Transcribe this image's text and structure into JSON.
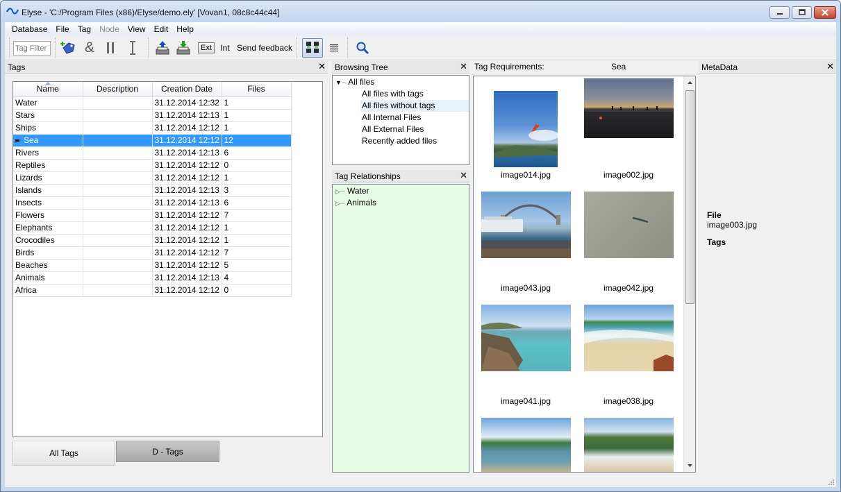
{
  "window": {
    "title": "Elyse - 'C:/Program Files (x86)/Elyse/demo.ely' [Vovan1, 08c8c44c44]"
  },
  "menu": [
    "Database",
    "File",
    "Tag",
    "Node",
    "View",
    "Edit",
    "Help"
  ],
  "toolbar": {
    "tag_filter_placeholder": "Tag Filter",
    "and_label": "&",
    "ext_label": "Ext",
    "int_label": "Int",
    "feedback_label": "Send feedback"
  },
  "tags_panel": {
    "title": "Tags",
    "columns": [
      "Name",
      "Description",
      "Creation Date",
      "Files"
    ],
    "rows": [
      {
        "name": "Water",
        "description": "",
        "date": "31.12.2014 12:32",
        "files": "1"
      },
      {
        "name": "Stars",
        "description": "",
        "date": "31.12.2014 12:13",
        "files": "1"
      },
      {
        "name": "Ships",
        "description": "",
        "date": "31.12.2014 12:12",
        "files": "1"
      },
      {
        "name": "Sea",
        "description": "",
        "date": "31.12.2014 12:12",
        "files": "12",
        "selected": true
      },
      {
        "name": "Rivers",
        "description": "",
        "date": "31.12.2014 12:13",
        "files": "6"
      },
      {
        "name": "Reptiles",
        "description": "",
        "date": "31.12.2014 12:12",
        "files": "0"
      },
      {
        "name": "Lizards",
        "description": "",
        "date": "31.12.2014 12:12",
        "files": "1"
      },
      {
        "name": "Islands",
        "description": "",
        "date": "31.12.2014 12:13",
        "files": "3"
      },
      {
        "name": "Insects",
        "description": "",
        "date": "31.12.2014 12:13",
        "files": "6"
      },
      {
        "name": "Flowers",
        "description": "",
        "date": "31.12.2014 12:12",
        "files": "7"
      },
      {
        "name": "Elephants",
        "description": "",
        "date": "31.12.2014 12:12",
        "files": "1"
      },
      {
        "name": "Crocodiles",
        "description": "",
        "date": "31.12.2014 12:12",
        "files": "1"
      },
      {
        "name": "Birds",
        "description": "",
        "date": "31.12.2014 12:12",
        "files": "7"
      },
      {
        "name": "Beaches",
        "description": "",
        "date": "31.12.2014 12:12",
        "files": "5"
      },
      {
        "name": "Animals",
        "description": "",
        "date": "31.12.2014 12:13",
        "files": "4"
      },
      {
        "name": "Africa",
        "description": "",
        "date": "31.12.2014 12:12",
        "files": "0"
      }
    ],
    "tabs": [
      "All Tags",
      "D - Tags"
    ]
  },
  "browsing_tree": {
    "title": "Browsing Tree",
    "root": "All files",
    "items": [
      "All files with tags",
      "All files without tags",
      "All Internal Files",
      "All External Files",
      "Recently added files"
    ]
  },
  "tag_relationships": {
    "title": "Tag Relationships",
    "items": [
      "Water",
      "Animals"
    ]
  },
  "image_view": {
    "requirements_label": "Tag Requirements:",
    "requirements_value": "Sea",
    "images": [
      "image014.jpg",
      "image002.jpg",
      "image043.jpg",
      "image042.jpg",
      "image041.jpg",
      "image038.jpg",
      "",
      ""
    ]
  },
  "metadata": {
    "title": "MetaData",
    "file_label": "File",
    "file_value": "image003.jpg",
    "tags_label": "Tags"
  },
  "colors": {
    "selection": "#3399ff",
    "relationships_bg": "#e6fbe6"
  }
}
